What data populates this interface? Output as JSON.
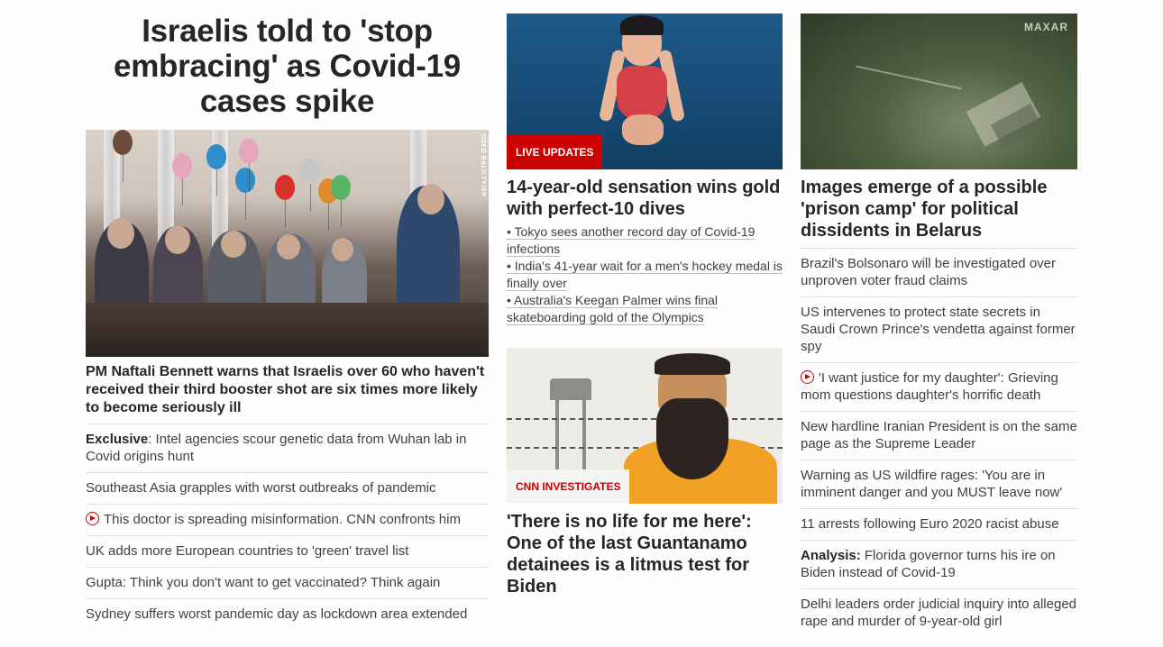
{
  "hero": {
    "title": "Israelis told to 'stop embracing' as Covid-19 cases spike",
    "photo_credit": "ODED BALILTY/AP",
    "lead": "PM Naftali Bennett warns that Israelis over 60 who haven't received their third booster shot are six times more likely to become seriously ill"
  },
  "left_list": [
    {
      "prefix": "Exclusive",
      "text": ": Intel agencies scour genetic data from Wuhan lab in Covid origins hunt"
    },
    {
      "text": "Southeast Asia grapples with worst outbreaks of pandemic"
    },
    {
      "video": true,
      "text": "This doctor is spreading misinformation. CNN confronts him"
    },
    {
      "text": "UK adds more European countries to 'green' travel list"
    },
    {
      "text": "Gupta: Think you don't want to get vaccinated? Think again"
    },
    {
      "text": "Sydney suffers worst pandemic day as lockdown area extended"
    }
  ],
  "olympics": {
    "badge": "LIVE UPDATES",
    "title": "14-year-old sensation wins gold with perfect-10 dives",
    "links": [
      "• Tokyo sees another record day of Covid-19 infections",
      "• India's 41-year wait for a men's hockey medal is finally over",
      "• Australia's Keegan Palmer wins final skateboarding gold of the Olympics"
    ]
  },
  "investigates": {
    "badge": "CNN INVESTIGATES",
    "title": "'There is no life for me here': One of the last Guantanamo detainees is a litmus test for Biden"
  },
  "belarus": {
    "logo": "MAXAR",
    "title": "Images emerge of a possible 'prison camp' for political dissidents in Belarus"
  },
  "right_list": [
    {
      "text": "Brazil's Bolsonaro will be investigated over unproven voter fraud claims"
    },
    {
      "text": "US intervenes to protect state secrets in Saudi Crown Prince's vendetta against former spy"
    },
    {
      "video": true,
      "text": "'I want justice for my daughter': Grieving mom questions daughter's horrific death"
    },
    {
      "text": "New hardline Iranian President is on the same page as the Supreme Leader"
    },
    {
      "text": "Warning as US wildfire rages: 'You are in imminent danger and you MUST leave now'"
    },
    {
      "text": "11 arrests following Euro 2020 racist abuse"
    },
    {
      "prefix": "Analysis:",
      "text": " Florida governor turns his ire on Biden instead of Covid-19"
    },
    {
      "text": "Delhi leaders order judicial inquiry into alleged rape and murder of 9-year-old girl"
    }
  ],
  "colors": {
    "accent_red": "#cc0000",
    "text": "#262626",
    "divider": "#dedede"
  }
}
